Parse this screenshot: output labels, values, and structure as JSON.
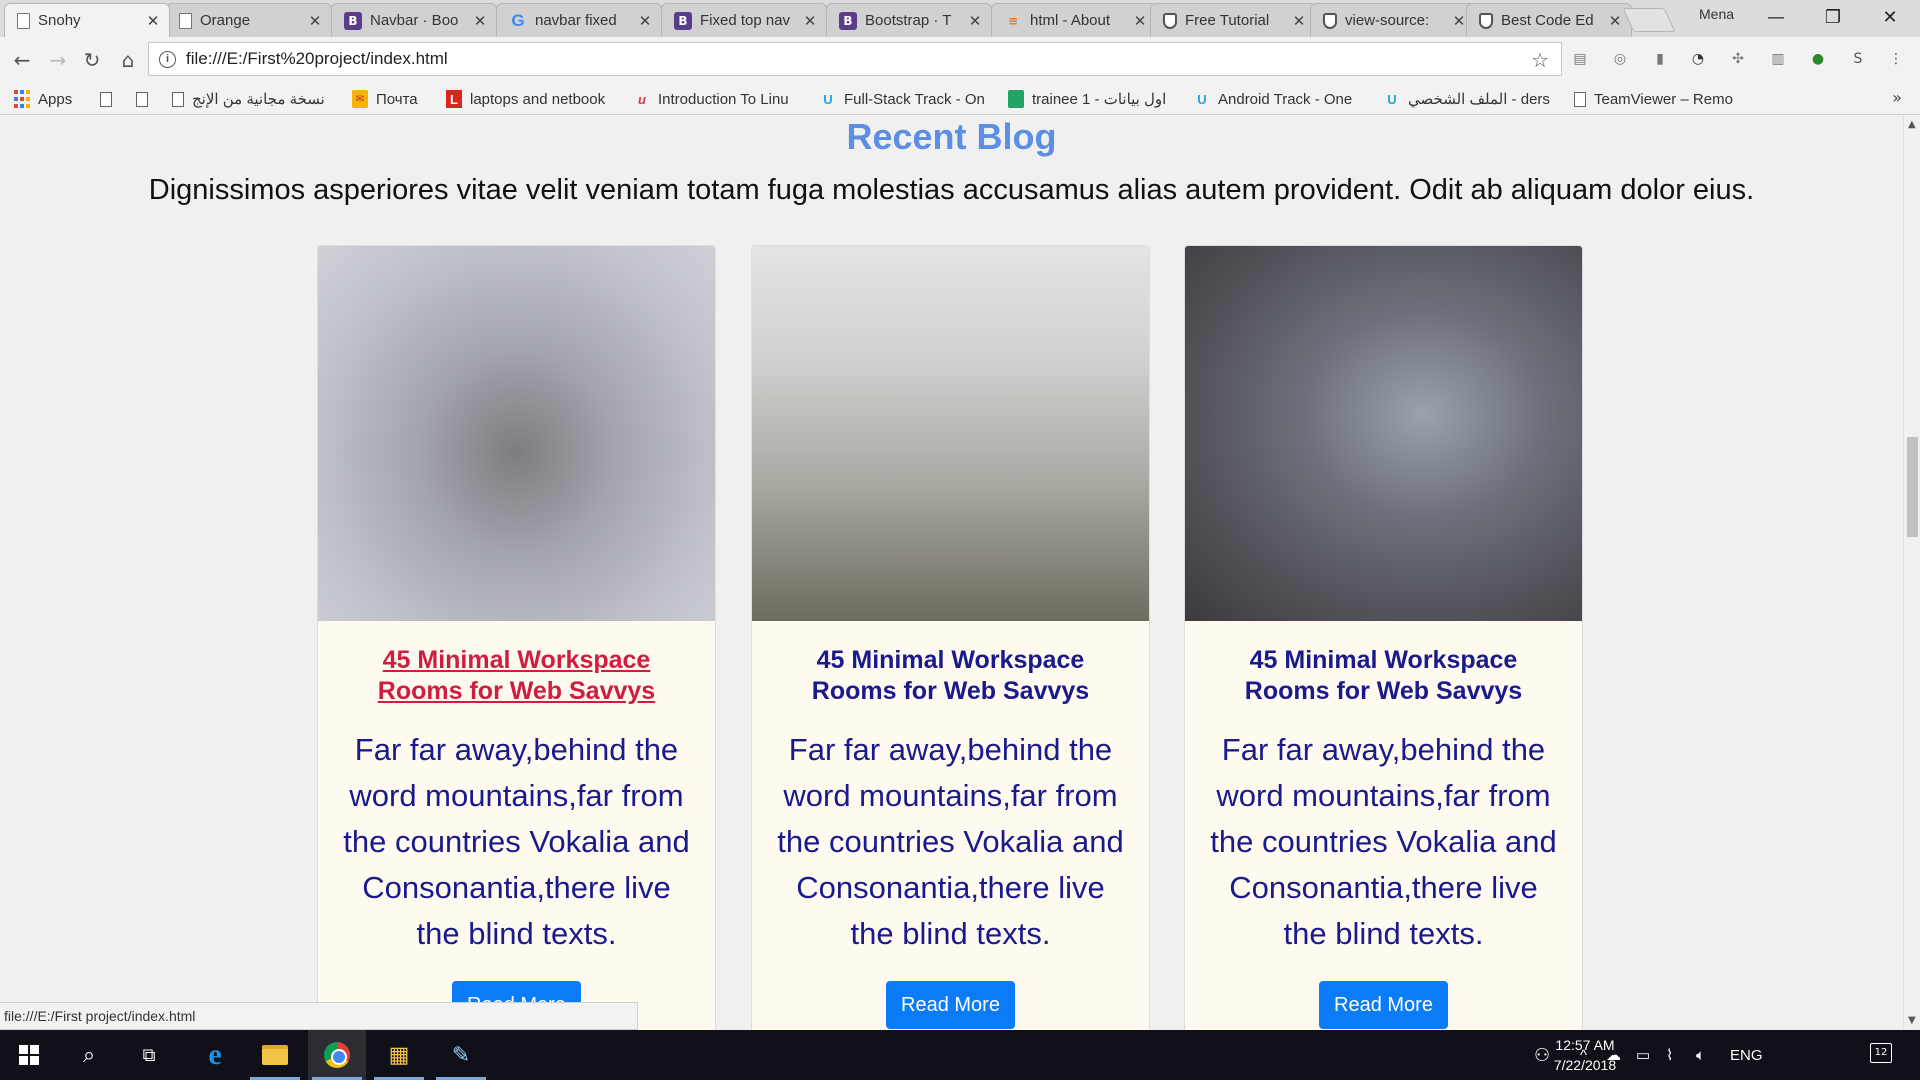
{
  "browser": {
    "tabs": [
      {
        "title": "Snohy",
        "icon": "page-icon",
        "active": true
      },
      {
        "title": "Orange",
        "icon": "page-icon"
      },
      {
        "title": "Navbar · Boo",
        "icon": "bootstrap-icon"
      },
      {
        "title": "navbar fixed",
        "icon": "google-icon"
      },
      {
        "title": "Fixed top nav",
        "icon": "bootstrap-icon"
      },
      {
        "title": "Bootstrap · T",
        "icon": "bootstrap-icon"
      },
      {
        "title": "html - About",
        "icon": "stackoverflow-icon"
      },
      {
        "title": "Free Tutorial",
        "icon": "shield-icon"
      },
      {
        "title": "view-source:",
        "icon": "shield-icon"
      },
      {
        "title": "Best Code Ed",
        "icon": "shield-icon"
      }
    ],
    "profile_name": "Mena",
    "url": "file:///E:/First%20project/index.html",
    "bookmarks": [
      {
        "label": "Apps",
        "icon": "apps-icon"
      },
      {
        "label": "",
        "icon": "page-icon"
      },
      {
        "label": "",
        "icon": "page-icon"
      },
      {
        "label": "نسخة مجانية من الإنج",
        "icon": "page-icon"
      },
      {
        "label": "Почта",
        "icon": "mail-icon"
      },
      {
        "label": "laptops and netbook",
        "icon": "l-icon"
      },
      {
        "label": "Introduction To Linu",
        "icon": "udacity-icon"
      },
      {
        "label": "Full-Stack Track - On",
        "icon": "shield-icon"
      },
      {
        "label": "trainee 1 - اول بيانات",
        "icon": "sheets-icon"
      },
      {
        "label": "Android Track - One",
        "icon": "shield-icon"
      },
      {
        "label": "الملف الشخصي - ders",
        "icon": "shield-icon"
      },
      {
        "label": "TeamViewer – Remo",
        "icon": "page-icon"
      }
    ],
    "more_glyph": "»",
    "status_url": "file:///E:/First project/index.html"
  },
  "page": {
    "section_title": "Recent Blog",
    "section_subtitle": "Dignissimos asperiores vitae velit veniam totam fuga molestias accusamus alias autem provident. Odit ab aliquam dolor eius.",
    "cards": [
      {
        "title": "45 Minimal Workspace Rooms for Web Savvys",
        "text": "Far far away,behind the word mountains,far from the countries Vokalia and Consonantia,there live the blind texts.",
        "button": "Read More",
        "hovered": true
      },
      {
        "title": "45 Minimal Workspace Rooms for Web Savvys",
        "text": "Far far away,behind the word mountains,far from the countries Vokalia and Consonantia,there live the blind texts.",
        "button": "Read More"
      },
      {
        "title": "45 Minimal Workspace Rooms for Web Savvys",
        "text": "Far far away,behind the word mountains,far from the countries Vokalia and Consonantia,there live the blind texts.",
        "button": "Read More"
      }
    ]
  },
  "taskbar": {
    "language": "ENG",
    "time": "12:57 AM",
    "date": "7/22/2018",
    "notification_count": "12"
  },
  "colors": {
    "title_blue": "#5c8ee5",
    "card_text": "#1a1a8c",
    "hover_red": "#d01d3f",
    "button_blue": "#0a7cf7",
    "card_bg": "#fefaef"
  }
}
